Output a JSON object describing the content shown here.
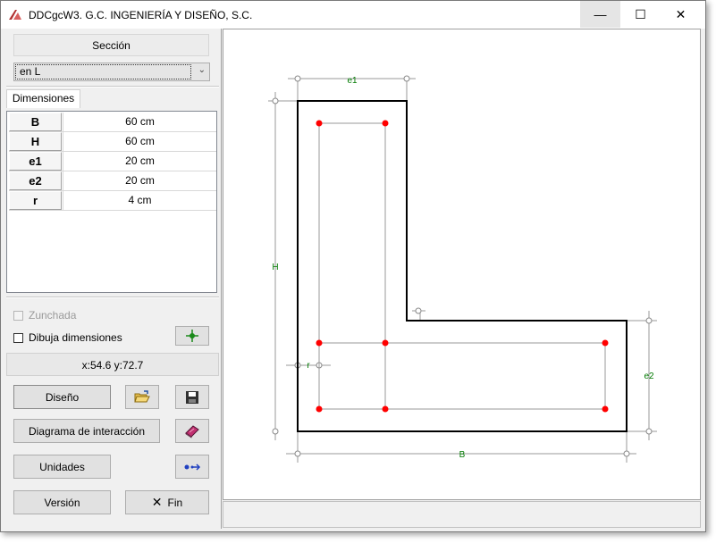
{
  "window": {
    "title": "DDCgcW3. G.C. INGENIERÍA Y DISEÑO, S.C.",
    "minimize_glyph": "—",
    "maximize_glyph": "☐",
    "close_glyph": "✕"
  },
  "section": {
    "label": "Sección",
    "selected": "en L",
    "dropdown_arrow": "⌄"
  },
  "tab": {
    "label": "Dimensiones"
  },
  "dimensions": [
    {
      "name": "B",
      "value": "60 cm"
    },
    {
      "name": "H",
      "value": "60 cm"
    },
    {
      "name": "e1",
      "value": "20 cm"
    },
    {
      "name": "e2",
      "value": "20 cm"
    },
    {
      "name": "r",
      "value": "4 cm"
    }
  ],
  "options": {
    "zunchada_label": "Zunchada",
    "zunchada_checked": false,
    "zunchada_enabled": false,
    "dibuja_label": "Dibuja dimensiones",
    "dibuja_checked": false
  },
  "coordinates": "x:54.6 y:72.7",
  "buttons": {
    "diseno": "Diseño",
    "diagrama": "Diagrama de interacción",
    "unidades": "Unidades",
    "version": "Versión",
    "fin": "Fin",
    "fin_glyph": "✕"
  },
  "icons": {
    "add_point": "crosshair-icon",
    "open": "open-folder-icon",
    "save": "floppy-disk-icon",
    "book": "book-icon",
    "units": "arrow-swap-icon"
  },
  "drawing": {
    "label_e1": "e1",
    "label_e2": "e2",
    "label_H": "H",
    "label_B": "B",
    "label_r": "r",
    "outline_color": "#000000",
    "rebar_color": "#ff0000",
    "dimension_color": "#007a00"
  }
}
